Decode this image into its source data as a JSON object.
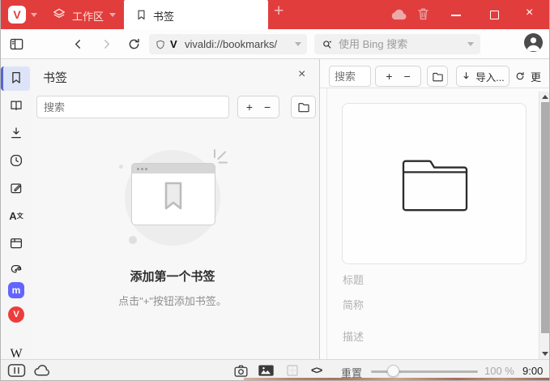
{
  "tabbar": {
    "workspace_label": "工作区",
    "tab_title": "书签"
  },
  "navbar": {
    "address_value": "vivaldi://bookmarks/",
    "search_placeholder": "使用 Bing 搜索"
  },
  "panel": {
    "title": "书签",
    "search_placeholder": "搜索",
    "empty_heading": "添加第一个书签",
    "empty_hint": "点击\"+\"按钮添加书签。"
  },
  "content": {
    "search_placeholder": "搜索",
    "import_label": "导入...",
    "more_label": "更",
    "title_placeholder": "标题",
    "nickname_placeholder": "简称",
    "description_placeholder": "描述"
  },
  "statusbar": {
    "reset_label": "重置",
    "zoom_level": "100 %",
    "clock": "9:00"
  },
  "icons": {
    "logo_glyph": "V",
    "new_tab": "+",
    "close_window": "×",
    "close_panel": "×",
    "plus": "+",
    "minus": "−",
    "code": "<>",
    "translate_main": "A",
    "translate_sub": "文",
    "mastodon_glyph": "m",
    "vivaldi_glyph": "V",
    "wikipedia_glyph": "W"
  },
  "colors": {
    "accent_red": "#e23d3d",
    "active_item_bg": "#dee4f8",
    "active_item_bar": "#5166d6",
    "mastodon_purple": "#6364ff",
    "vivaldi_badge_red": "#ee3c3c"
  }
}
